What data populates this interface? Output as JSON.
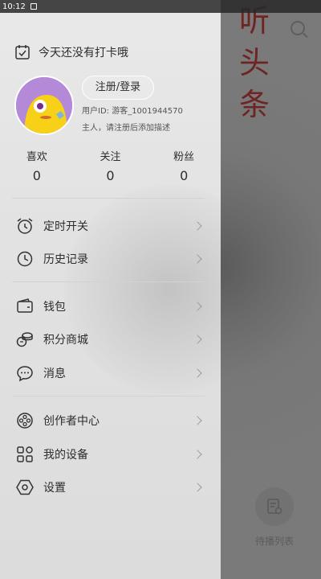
{
  "status_bar": {
    "time": "10:12"
  },
  "background": {
    "title_chars": [
      "听",
      "头",
      "条"
    ],
    "queue_label": "待播列表"
  },
  "drawer": {
    "checkin_text": "今天还没有打卡哦",
    "register_label": "注册/登录",
    "user_id": "用户ID: 游客_1001944570",
    "user_desc": "主人，请注册后添加描述",
    "stats": [
      {
        "label": "喜欢",
        "value": "0"
      },
      {
        "label": "关注",
        "value": "0"
      },
      {
        "label": "粉丝",
        "value": "0"
      }
    ],
    "menu": [
      {
        "label": "定时开关",
        "icon": "alarm-clock-icon"
      },
      {
        "label": "历史记录",
        "icon": "clock-icon"
      },
      {
        "label": "钱包",
        "icon": "wallet-icon"
      },
      {
        "label": "积分商城",
        "icon": "coins-icon"
      },
      {
        "label": "消息",
        "icon": "chat-bubble-icon"
      },
      {
        "label": "创作者中心",
        "icon": "film-reel-icon"
      },
      {
        "label": "我的设备",
        "icon": "devices-grid-icon"
      },
      {
        "label": "设置",
        "icon": "gear-hexagon-icon"
      }
    ]
  },
  "colors": {
    "title_red": "#6f2424",
    "avatar_bg": "#b48ad8",
    "avatar_character": "#f7d117"
  }
}
